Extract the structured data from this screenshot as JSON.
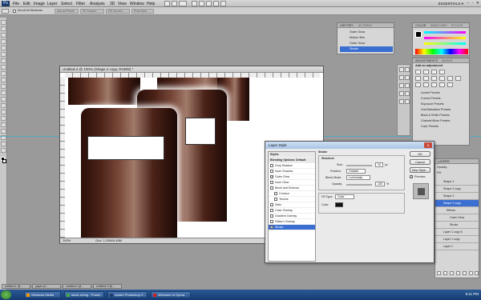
{
  "app": {
    "logo": "Ps",
    "menus": [
      "File",
      "Edit",
      "Image",
      "Layer",
      "Select",
      "Filter",
      "Analysis",
      "3D",
      "View",
      "Window",
      "Help"
    ],
    "workspace": "ESSENTIALS ▾",
    "window_controls": "– ▫ ✕"
  },
  "options_bar": {
    "scroll_all": "Scroll All Windows",
    "actual_pixels": "Actual Pixels",
    "fit_screen": "Fit Screen",
    "fill_screen": "Fill Screen",
    "print_size": "Print Size"
  },
  "document": {
    "title": "Untitled-3 @ 100% (Shape 2 copy, RGB/8) *",
    "status": "Doc: 1.29M/4.48M",
    "zoom": "100%"
  },
  "history": {
    "tab": "HISTORY",
    "tab2": "ACTIONS",
    "items": [
      "Outer Glow",
      "Motion Blur",
      "Outer Glow",
      "Stroke"
    ],
    "selected_index": 3
  },
  "color": {
    "tab": "COLOR",
    "tab2": "SWATCHES",
    "tab3": "STYLES"
  },
  "adjustments": {
    "tab": "ADJUSTMENTS",
    "tab2": "MASKS",
    "heading": "Add an adjustment",
    "items": [
      "Levels Presets",
      "Curves Presets",
      "Exposure Presets",
      "Hue/Saturation Presets",
      "Black & White Presets",
      "Channel Mixer Presets",
      "Color Presets"
    ]
  },
  "layers": {
    "tab": "LAYERS",
    "opacity_label": "Opacity:",
    "fill_label": "Fill:",
    "items": [
      "Shape 1",
      "Shape 2 copy",
      "Shape 2",
      "Shape 2 copy",
      "Effects",
      "Outer Glow",
      "Stroke",
      "Layer 1 copy 5",
      "Layer 1 copy",
      "Layer 1"
    ],
    "selected_index": 3
  },
  "dialog": {
    "title": "Layer Style",
    "styles_header": "Styles",
    "blending": "Blending Options: Default",
    "effects": [
      {
        "label": "Drop Shadow",
        "checked": false
      },
      {
        "label": "Inner Shadow",
        "checked": false
      },
      {
        "label": "Outer Glow",
        "checked": true
      },
      {
        "label": "Inner Glow",
        "checked": false
      },
      {
        "label": "Bevel and Emboss",
        "checked": false
      },
      {
        "label": "Contour",
        "checked": false
      },
      {
        "label": "Texture",
        "checked": false
      },
      {
        "label": "Satin",
        "checked": false
      },
      {
        "label": "Color Overlay",
        "checked": false
      },
      {
        "label": "Gradient Overlay",
        "checked": false
      },
      {
        "label": "Pattern Overlay",
        "checked": false
      },
      {
        "label": "Stroke",
        "checked": true
      }
    ],
    "section": "Stroke",
    "subsection": "Structure",
    "size_label": "Size:",
    "size_value": "10",
    "size_unit": "px",
    "position_label": "Position:",
    "position_value": "Outside",
    "blend_label": "Blend Mode:",
    "blend_value": "Luminosity",
    "opacity_label": "Opacity:",
    "opacity_value": "100",
    "opacity_unit": "%",
    "fill_type_label": "Fill Type:",
    "fill_type_value": "Color",
    "color_label": "Color:",
    "stroke_color": "#111111",
    "ok": "OK",
    "cancel": "Cancel",
    "new_style": "New Style...",
    "preview": "Preview",
    "preview_checked": true
  },
  "doc_tabs": [
    "untitled-1 @...",
    "paper pl...",
    "untitled-2 @...",
    "Untitled-3 @..."
  ],
  "taskbar": {
    "items": [
      "Windows Media Player",
      "stock.xchng - Power...",
      "Adobe Photoshop C...",
      "Welcome to Opera"
    ],
    "clock": "9:11 PM"
  },
  "colors": {
    "selection": "#3a6fd1",
    "taskbar": "#133b70"
  }
}
